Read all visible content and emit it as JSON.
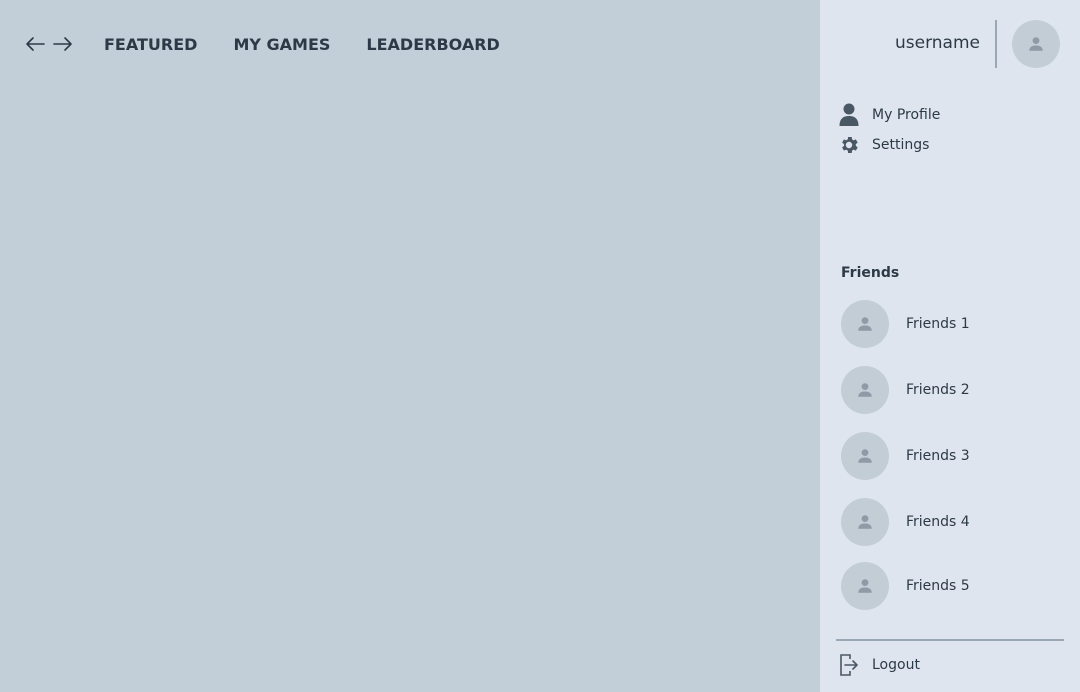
{
  "nav": {
    "back_icon": "arrow-left-icon",
    "forward_icon": "arrow-right-icon",
    "tabs": [
      {
        "label": "FEATURED"
      },
      {
        "label": "MY GAMES"
      },
      {
        "label": "LEADERBOARD"
      }
    ]
  },
  "user": {
    "username": "username",
    "avatar_icon": "person-icon"
  },
  "menu": {
    "items": [
      {
        "label": "My Profile",
        "icon": "person-icon"
      },
      {
        "label": "Settings",
        "icon": "gear-icon"
      }
    ]
  },
  "friends": {
    "title": "Friends",
    "items": [
      {
        "name": "Friends 1"
      },
      {
        "name": "Friends 2"
      },
      {
        "name": "Friends 3"
      },
      {
        "name": "Friends 4"
      },
      {
        "name": "Friends 5"
      }
    ]
  },
  "logout": {
    "label": "Logout",
    "icon": "logout-icon"
  },
  "colors": {
    "main_bg": "#c2cfd8",
    "panel_bg": "#dfe5ee",
    "text": "#2c3a47",
    "avatar_bg": "#c2cdd6",
    "avatar_icon": "#8e9aa6"
  }
}
